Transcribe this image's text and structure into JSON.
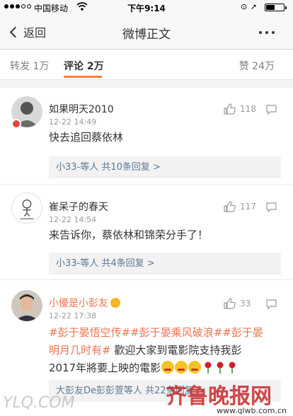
{
  "status_bar": {
    "carrier": "中国移动",
    "time": "下午9:14",
    "battery_level": 0.51,
    "battery_percent": "51%"
  },
  "nav": {
    "back_label": "返回",
    "title": "微博正文"
  },
  "tabs": {
    "repost": "转发 1万",
    "comments": "评论 2万",
    "likes": "赞 24万"
  },
  "comments": [
    {
      "username": "如果明天2010",
      "time": "12-22 14:49",
      "likes": "118",
      "text": "快去追回蔡依林",
      "reply_users": "小33-等人",
      "reply_count": "共10条回复 >"
    },
    {
      "username": "崔呆子的春天",
      "time": "12-22 14:54",
      "likes": "117",
      "text": "来告诉你，蔡依林和锦荣分手了！",
      "reply_users": "小33-等人",
      "reply_count": "共4条回复 >"
    },
    {
      "username": "小優是小彭友",
      "time": "12-22 17:38",
      "likes": "33",
      "tag1": "#彭于晏悟空传#",
      "tag2": "#彭于晏乘风破浪#",
      "tag3_line1": "#彭于晏",
      "tag3_line2": "明月几时有#",
      "text_line2": "歡迎大家到電影院支持我彭",
      "text_line3": "2017年將要上映的電影",
      "reply_users": "大彭友De彭彭萱等人",
      "reply_count": "共22条回复 >"
    }
  ],
  "watermarks": {
    "left": "YLQ.COM",
    "brand": "齐鲁晚报网",
    "url": "www.qlwb.com.cn"
  },
  "colors": {
    "accent_orange": "#fa7d3c",
    "link_blue": "#5d7895",
    "hashtag": "#eb7350"
  }
}
